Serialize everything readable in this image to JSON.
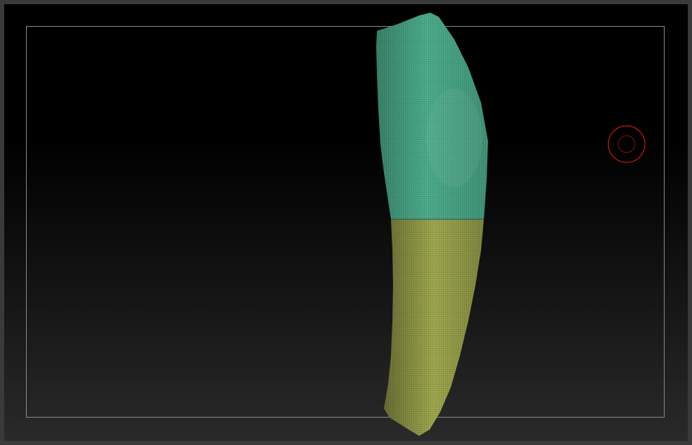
{
  "viewport": {
    "background_top": "#000000",
    "background_bottom": "#2a2a2a",
    "frame_color": "#8a8a8a"
  },
  "mesh": {
    "upper_polygroup_color": "#4fb08e",
    "lower_polygroup_color": "#a3ac52",
    "wireframe_visible": true
  },
  "brush": {
    "icon": "brush-cursor-icon",
    "ring_color": "#cc1a1a"
  }
}
